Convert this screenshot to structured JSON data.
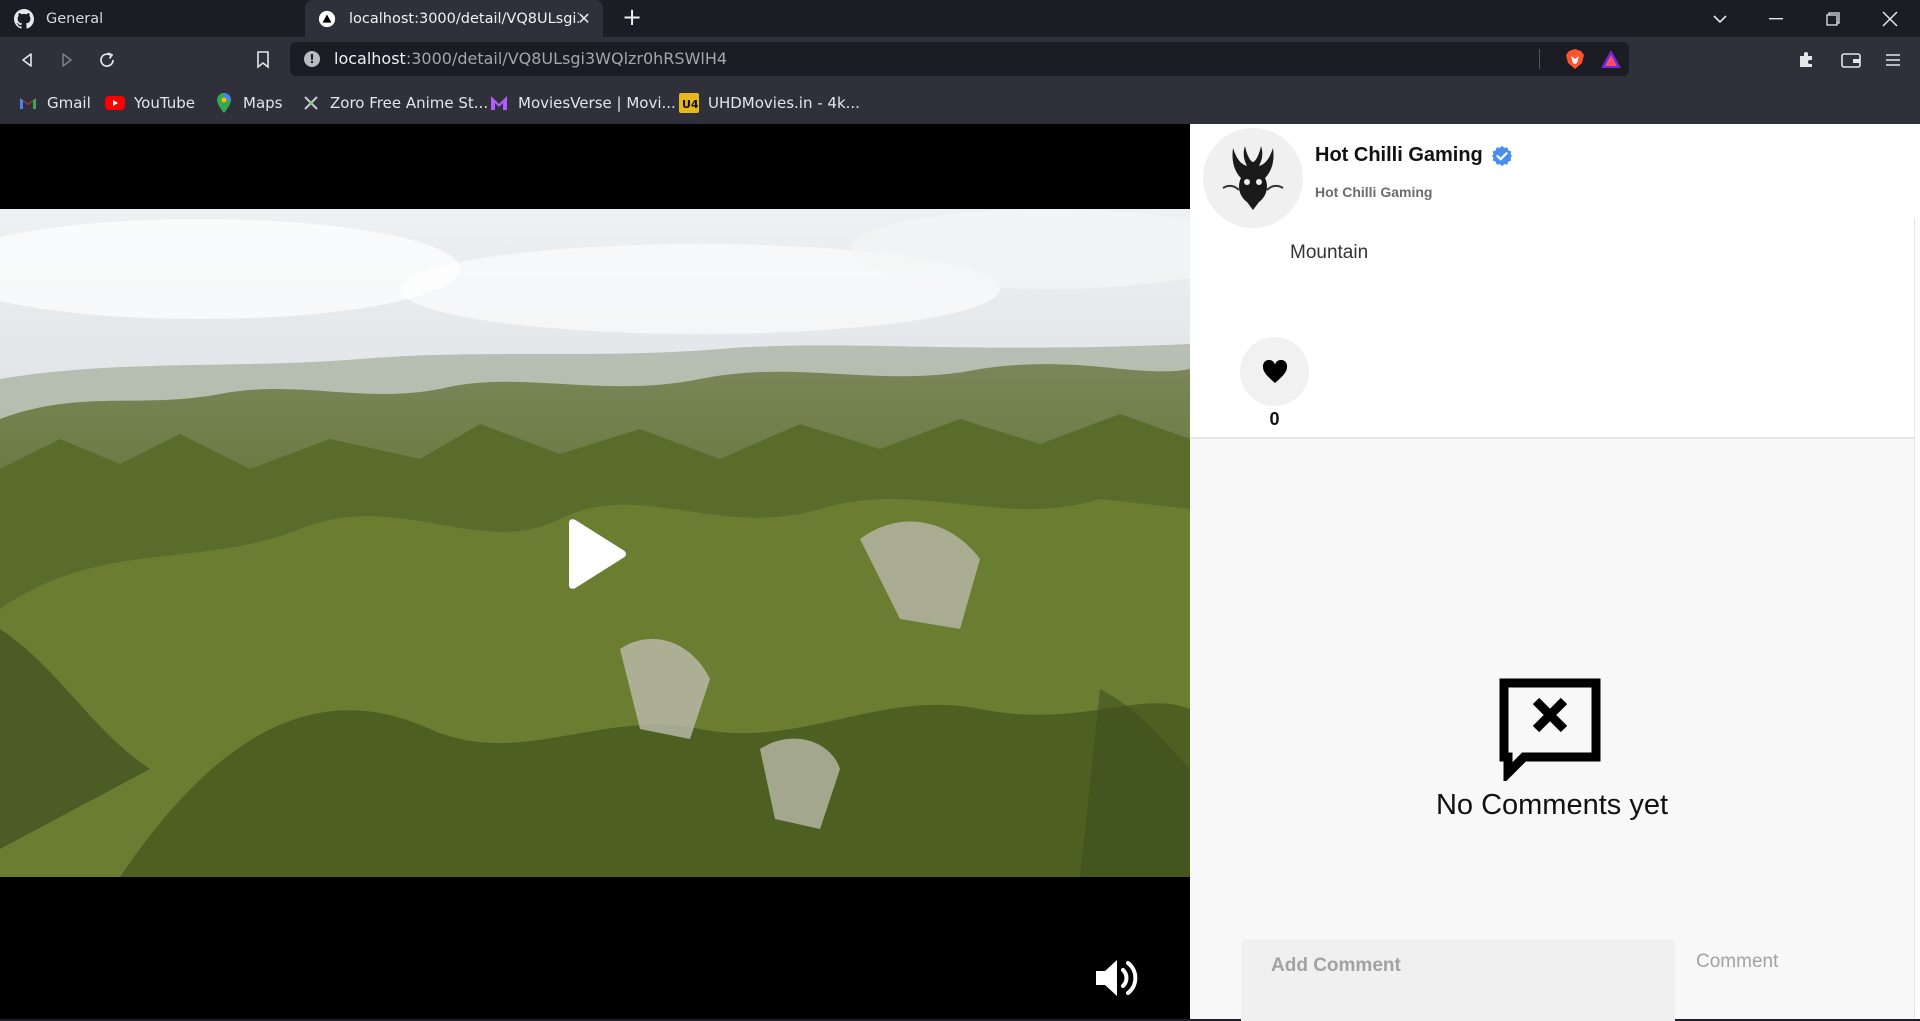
{
  "browser": {
    "tabs": [
      {
        "title": "General",
        "icon": "github-icon",
        "active": false
      },
      {
        "title": "localhost:3000/detail/VQ8ULsgi3WQlzr0hRSWlH4",
        "icon": "vercel-triangle-icon",
        "active": true
      }
    ],
    "url_host": "localhost",
    "url_rest": ":3000/detail/VQ8ULsgi3WQlzr0hRSWlH4",
    "bookmarks": [
      {
        "label": "Gmail",
        "icon": "gmail-icon"
      },
      {
        "label": "YouTube",
        "icon": "youtube-icon"
      },
      {
        "label": "Maps",
        "icon": "maps-icon"
      },
      {
        "label": "Zoro Free Anime St...",
        "icon": "zoro-icon"
      },
      {
        "label": "MoviesVerse | Movi...",
        "icon": "moviesverse-icon"
      },
      {
        "label": "UHDMovies.in - 4k...",
        "icon": "uhdmovies-icon"
      }
    ],
    "colors": {
      "chrome_dark": "#1b1c24",
      "chrome": "#2f303a",
      "brave_orange": "#fb542b"
    }
  },
  "video": {
    "state": "paused",
    "muted": false
  },
  "post": {
    "user_name": "Hot Chilli Gaming",
    "user_handle": "Hot Chilli Gaming",
    "verified": true,
    "caption": "Mountain",
    "likes": "0"
  },
  "comments": {
    "empty_text": "No Comments yet",
    "input_placeholder": "Add Comment",
    "submit_label": "Comment"
  }
}
